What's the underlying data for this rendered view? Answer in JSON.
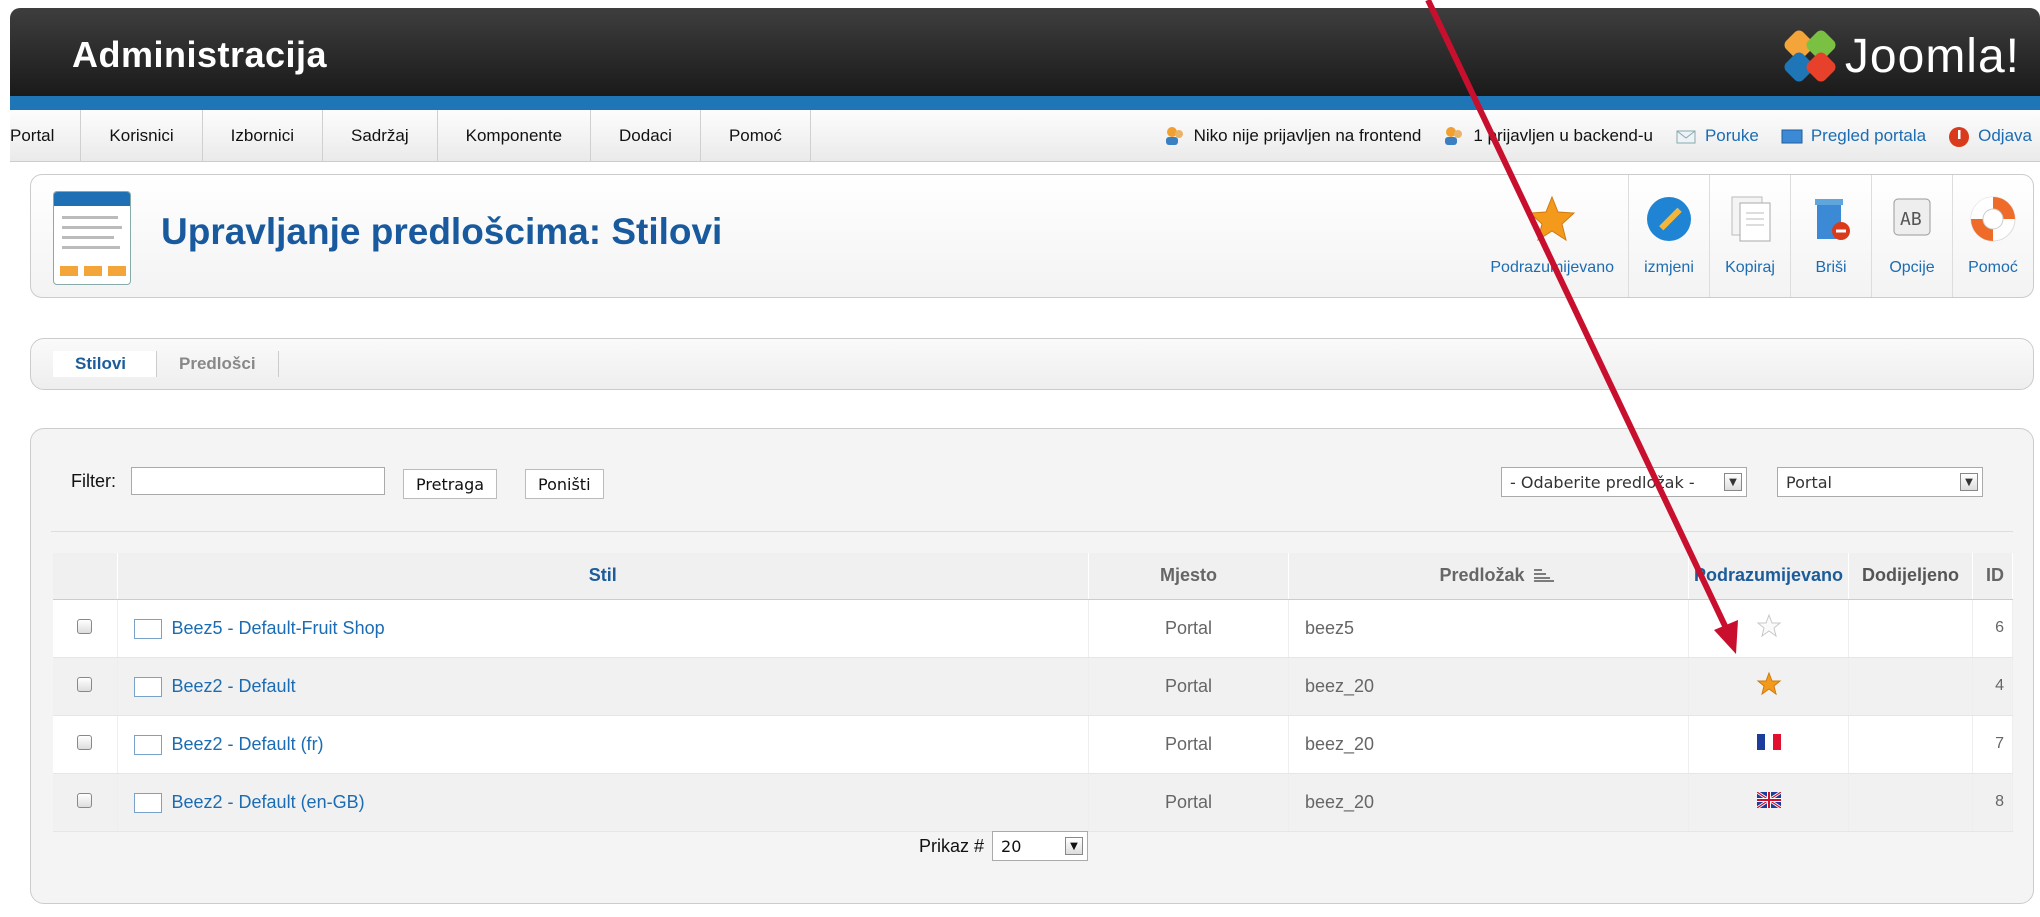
{
  "header": {
    "title": "Administracija",
    "brand": "Joomla!"
  },
  "menu": {
    "items": [
      "Portal",
      "Korisnici",
      "Izbornici",
      "Sadržaj",
      "Komponente",
      "Dodaci",
      "Pomoć"
    ],
    "status": {
      "frontend": "Niko nije prijavljen na frontend",
      "backend": "1 prijavljen u backend-u",
      "messages": "Poruke",
      "preview": "Pregled portala",
      "logout": "Odjava"
    }
  },
  "page": {
    "title": "Upravljanje predlošcima: Stilovi"
  },
  "toolbar": {
    "default": "Podrazumijevano",
    "edit": "izmjeni",
    "copy": "Kopiraj",
    "delete": "Briši",
    "options": "Opcije",
    "help": "Pomoć"
  },
  "tabs": [
    "Stilovi",
    "Predlošci"
  ],
  "filter": {
    "label": "Filter:",
    "value": "",
    "search_button": "Pretraga",
    "reset_button": "Poništi",
    "template_select": "- Odaberite predložak -",
    "location_select": "Portal"
  },
  "table": {
    "headers": [
      "Stil",
      "Mjesto",
      "Predložak",
      "Podrazumijevano",
      "Dodijeljeno",
      "ID"
    ],
    "rows": [
      {
        "style": "Beez5 - Default-Fruit Shop",
        "location": "Portal",
        "template": "beez5",
        "default": "star-empty",
        "id": "6"
      },
      {
        "style": "Beez2 - Default",
        "location": "Portal",
        "template": "beez_20",
        "default": "star-filled",
        "id": "4"
      },
      {
        "style": "Beez2 - Default (fr)",
        "location": "Portal",
        "template": "beez_20",
        "default": "flag-fr",
        "id": "7"
      },
      {
        "style": "Beez2 - Default (en-GB)",
        "location": "Portal",
        "template": "beez_20",
        "default": "flag-gb",
        "id": "8"
      }
    ]
  },
  "pager": {
    "label": "Prikaz #",
    "value": "20"
  },
  "colors": {
    "accent": "#1f76b7",
    "link": "#1c6cb3",
    "title": "#185a9d",
    "annotation_arrow": "#c8102e"
  }
}
